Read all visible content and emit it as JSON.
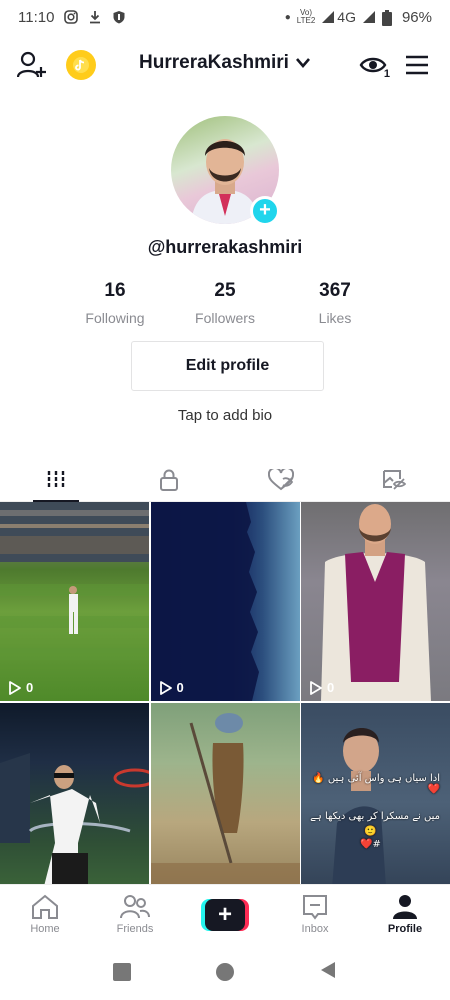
{
  "status_bar": {
    "time": "11:10",
    "network_top": "Vo)",
    "network_bottom": "LTE2",
    "signal_label": "4G",
    "battery": "96%"
  },
  "top_bar": {
    "username": "HurreraKashmiri",
    "views_badge": "1"
  },
  "profile": {
    "handle": "@hurrerakashmiri",
    "avatar_add": "+",
    "stats": [
      {
        "value": "16",
        "label": "Following"
      },
      {
        "value": "25",
        "label": "Followers"
      },
      {
        "value": "367",
        "label": "Likes"
      }
    ],
    "edit_profile_label": "Edit profile",
    "bio_prompt": "Tap to add bio"
  },
  "tabs": [
    {
      "icon": "grid-icon",
      "active": true
    },
    {
      "icon": "lock-icon",
      "active": false
    },
    {
      "icon": "liked-hidden-icon",
      "active": false
    },
    {
      "icon": "tagged-hidden-icon",
      "active": false
    }
  ],
  "videos": [
    {
      "views": "0"
    },
    {
      "views": "0"
    },
    {
      "views": "0"
    },
    {
      "views": ""
    },
    {
      "views": ""
    },
    {
      "views": "",
      "caption_line1": "ادا سیاں ہی واس آئی ہیں 🔥❤️",
      "caption_line2": "میں نے مسکرا کر بھی دیکھا ہے",
      "caption_line3": "🙂",
      "caption_line4": "#❤️"
    }
  ],
  "bottom_nav": {
    "home": "Home",
    "friends": "Friends",
    "create": "+",
    "inbox": "Inbox",
    "profile": "Profile"
  },
  "colors": {
    "accent_cyan": "#25f4ee",
    "accent_pink": "#fe2c55",
    "avatar_add": "#20d5ec",
    "text_primary": "#161823",
    "text_secondary": "#8a8b91"
  }
}
